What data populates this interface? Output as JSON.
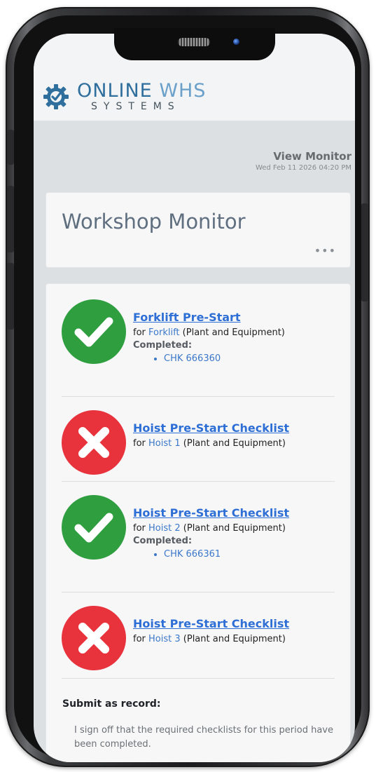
{
  "brand": {
    "name_primary": "ONLINE",
    "name_secondary": "WHS",
    "name_sub": "SYSTEMS"
  },
  "header": {
    "view_title": "View Monitor",
    "datetime": "Wed Feb 11 2026 04:20 PM"
  },
  "page": {
    "title": "Workshop Monitor",
    "more_label": "•••"
  },
  "items": [
    {
      "status": "complete",
      "title": "Forklift Pre-Start",
      "for_prefix": "for",
      "asset": "Forklift",
      "category": "(Plant and Equipment)",
      "completed_label": "Completed:",
      "records": [
        "CHK 666360"
      ]
    },
    {
      "status": "incomplete",
      "title": "Hoist Pre-Start Checklist",
      "for_prefix": "for",
      "asset": "Hoist 1",
      "category": "(Plant and Equipment)"
    },
    {
      "status": "complete",
      "title": "Hoist Pre-Start Checklist",
      "for_prefix": "for",
      "asset": "Hoist 2",
      "category": "(Plant and Equipment)",
      "completed_label": "Completed:",
      "records": [
        "CHK 666361"
      ]
    },
    {
      "status": "incomplete",
      "title": "Hoist Pre-Start Checklist",
      "for_prefix": "for",
      "asset": "Hoist 3",
      "category": "(Plant and Equipment)"
    }
  ],
  "submit": {
    "label": "Submit as record:",
    "signoff_text": "I sign off that the required checklists for this period have been completed."
  },
  "colors": {
    "success": "#2e9e3f",
    "danger": "#e8323c",
    "link": "#2e6fd6",
    "brand": "#2f6f9e"
  }
}
